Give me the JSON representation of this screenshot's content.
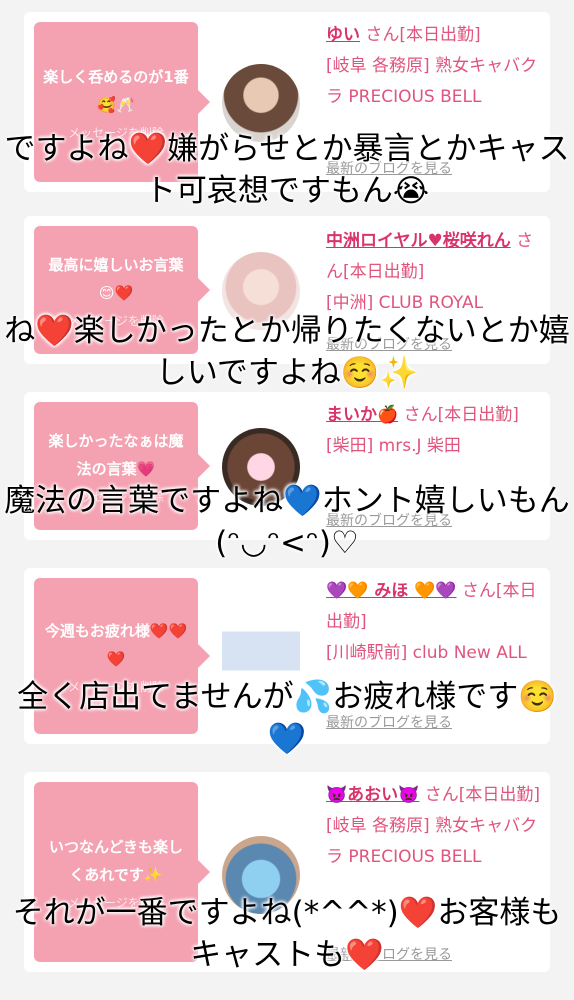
{
  "cards": [
    {
      "bubble": "楽しく呑めるのが1番🥰🥂",
      "delete": "メッセージを削除",
      "name": "ゆい",
      "san": "さん",
      "status": "[本日出勤]",
      "shop": "[岐阜 各務原] 熟女キャバクラ PRECIOUS BELL",
      "blog": "最新のブログを見る",
      "overlay": "ですよね❤️嫌がらせとか暴言とかキャスト可哀想ですもん😭"
    },
    {
      "bubble": "最高に嬉しいお言葉😊❤️",
      "delete": "メッセージを削除",
      "name": "中洲ロイヤル♥桜咲れん",
      "san": "さん",
      "status": "[本日出勤]",
      "shop": "[中洲] CLUB ROYAL",
      "blog": "最新のブログを見る",
      "overlay": "ね❤️楽しかったとか帰りたくないとか嬉しいですよね☺️✨"
    },
    {
      "bubble": "楽しかったなぁは魔法の言葉💗",
      "delete": "メッセージを削除",
      "name": "まいか🍎",
      "san": "さん",
      "status": "[本日出勤]",
      "shop": "[柴田] mrs.J 柴田",
      "blog": "最新のブログを見る",
      "overlay": "魔法の言葉ですよね💙ホント嬉しいもん(ᵔ◡ᵔ<ᵔ)♡"
    },
    {
      "bubble": "今週もお疲れ様❤️❤️❤️",
      "delete": "メッセージを削除",
      "name": "💜🧡 みほ 🧡💜",
      "san": "さん",
      "status": "[本日出勤]",
      "shop": "[川崎駅前] club New ALL",
      "blog": "最新のブログを見る",
      "overlay": "全く店出てませんが💦お疲れ様です☺️💙"
    },
    {
      "bubble": "いつなんどきも楽しくあれです✨",
      "delete": "メッセージを削除",
      "name": "👿あおい👿",
      "san": "さん",
      "status": "[本日出勤]",
      "shop": "[岐阜 各務原] 熟女キャバクラ PRECIOUS BELL",
      "blog": "最新のブログを見る",
      "overlay": "それが一番ですよね(*^^*)❤️お客様もキャストも❤️"
    }
  ],
  "colors": {
    "bubble": "#f4a1b1",
    "accent": "#e0547d",
    "background": "#f3f3f4"
  }
}
